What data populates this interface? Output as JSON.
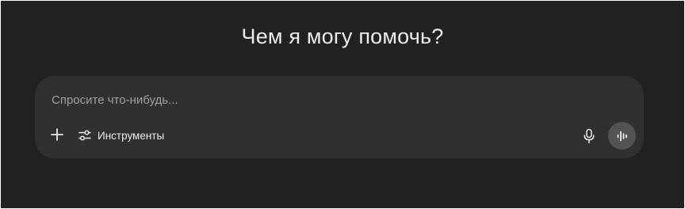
{
  "heading": "Чем я могу помочь?",
  "composer": {
    "placeholder": "Спросите что-нибудь...",
    "value": "",
    "tools_label": "Инструменты"
  },
  "icons": {
    "add": "plus-icon",
    "tools": "sliders-icon",
    "mic": "microphone-icon",
    "voice": "voice-waveform-icon"
  },
  "colors": {
    "background": "#212121",
    "composer": "#303030",
    "text": "#ececec",
    "placeholder": "#a0a0a0",
    "voice_button": "#535353"
  }
}
